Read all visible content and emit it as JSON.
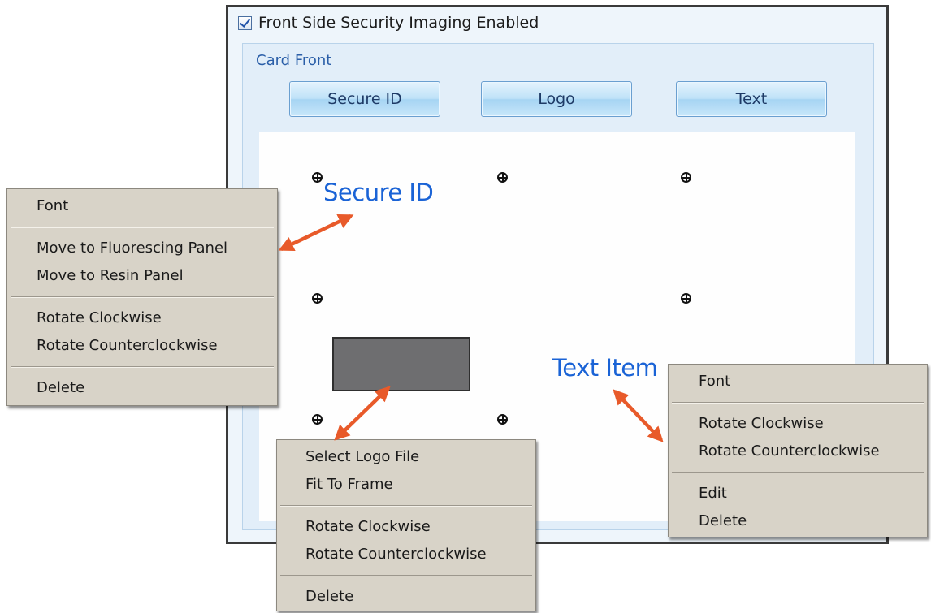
{
  "dialog": {
    "enable_label": "Front Side Security Imaging Enabled",
    "enable_checked": true,
    "group_title": "Card Front",
    "buttons": {
      "secure_id": "Secure ID",
      "logo": "Logo",
      "text": "Text"
    }
  },
  "overlay_labels": {
    "secure_id": "Secure ID",
    "text_item": "Text Item"
  },
  "secure_id_menu": {
    "font": "Font",
    "move_fluorescing": "Move to Fluorescing Panel",
    "move_resin": "Move to Resin Panel",
    "rotate_cw": "Rotate Clockwise",
    "rotate_ccw": "Rotate Counterclockwise",
    "delete": "Delete"
  },
  "logo_menu": {
    "select_logo": "Select Logo File",
    "fit_frame": "Fit To Frame",
    "rotate_cw": "Rotate Clockwise",
    "rotate_ccw": "Rotate Counterclockwise",
    "delete": "Delete"
  },
  "text_menu": {
    "font": "Font",
    "rotate_cw": "Rotate Clockwise",
    "rotate_ccw": "Rotate Counterclockwise",
    "edit": "Edit",
    "delete": "Delete"
  },
  "colors": {
    "arrow": "#e85a2a",
    "label_blue": "#1a63d6",
    "menu_bg": "#d8d3c8"
  },
  "icons": {
    "handle": "move-handle-icon",
    "check": "checkmark-icon"
  }
}
